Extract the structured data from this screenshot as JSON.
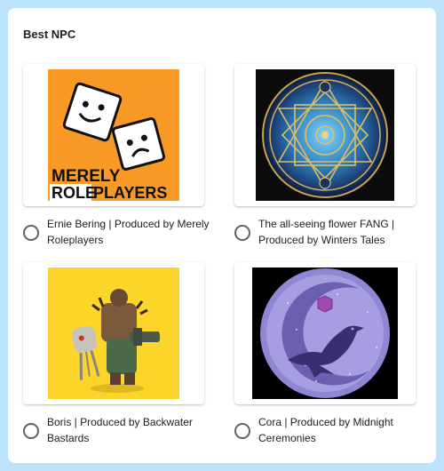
{
  "question": {
    "title": "Best NPC"
  },
  "options": [
    {
      "label": "Ernie Bering | Produced by Merely Roleplayers",
      "image": {
        "logo_line1": "MERELY",
        "logo_line2a": "ROLE",
        "logo_line2b": "PLAYERS",
        "background": "#f99a26"
      }
    },
    {
      "label": "The all-seeing flower FANG | Produced by Winters Tales",
      "image": {
        "background": "#0c0c0c"
      }
    },
    {
      "label": "Boris | Produced by Backwater Bastards",
      "image": {
        "background": "#fcd52a"
      }
    },
    {
      "label": "Cora | Produced by Midnight Ceremonies",
      "image": {
        "background": "#000000"
      }
    }
  ],
  "colors": {
    "page_bg": "#bde3fa",
    "card_bg": "#ffffff",
    "radio_border": "#5f6368"
  }
}
